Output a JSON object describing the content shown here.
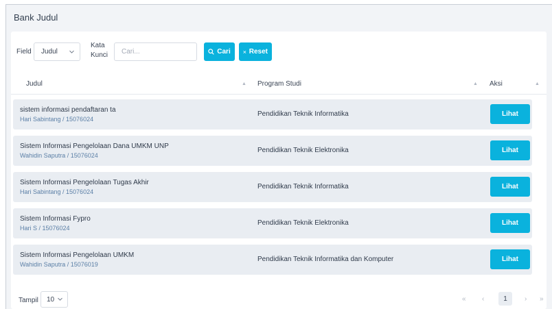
{
  "page": {
    "title": "Bank Judul"
  },
  "filter": {
    "field_label": "Field",
    "field_value": "Judul",
    "keyword_label_1": "Kata",
    "keyword_label_2": "Kunci",
    "search_placeholder": "Cari...",
    "search_button": "Cari",
    "reset_button": "Reset"
  },
  "table": {
    "columns": [
      "Judul",
      "Program Studi",
      "Aksi"
    ],
    "rows": [
      {
        "title": "sistem informasi pendaftaran ta",
        "author": "Hari Sabintang / 15076024",
        "program": "Pendidikan Teknik Informatika",
        "action": "Lihat"
      },
      {
        "title": "Sistem Informasi Pengelolaan Dana UMKM UNP",
        "author": "Wahidin Saputra / 15076024",
        "program": "Pendidikan Teknik Elektronika",
        "action": "Lihat"
      },
      {
        "title": "Sistem Informasi Pengelolaan Tugas Akhir",
        "author": "Hari Sabintang / 15076024",
        "program": "Pendidikan Teknik Informatika",
        "action": "Lihat"
      },
      {
        "title": "Sistem Informasi Fypro",
        "author": "Hari S / 15076024",
        "program": "Pendidikan Teknik Elektronika",
        "action": "Lihat"
      },
      {
        "title": "Sistem Informasi Pengelolaan UMKM",
        "author": "Wahidin Saputra / 15076019",
        "program": "Pendidikan Teknik Informatika dan Komputer",
        "action": "Lihat"
      }
    ]
  },
  "footer": {
    "show_label": "Tampil",
    "page_size": "10",
    "current_page": "1",
    "first": "«",
    "prev": "‹",
    "next": "›",
    "last": "»"
  },
  "colors": {
    "accent": "#0ab2dd",
    "row_bg": "#e9edf2",
    "subtext": "#5b7fa6"
  },
  "icons": [
    "search-icon",
    "close-icon",
    "chevron-down-icon",
    "sort-icon"
  ]
}
